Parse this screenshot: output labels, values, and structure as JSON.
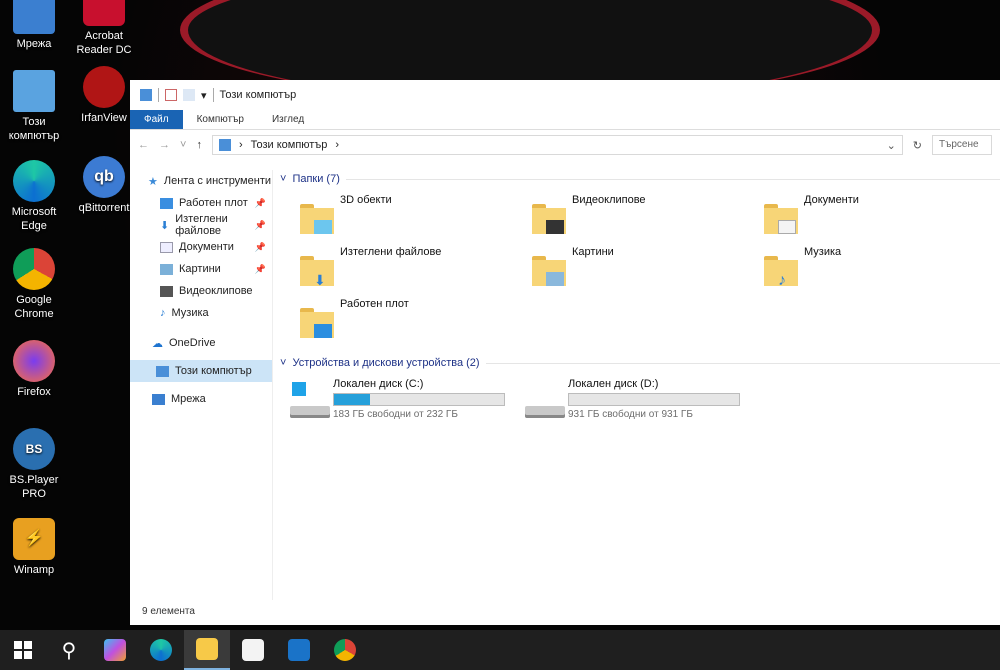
{
  "desktop": {
    "icons_left": [
      "Мрежа",
      "Този компютър",
      "Microsoft Edge",
      "Google Chrome",
      "Firefox",
      "BS.Player PRO",
      "Winamp"
    ],
    "icons_right": [
      "Acrobat Reader DC",
      "IrfanView",
      "qBittorrent"
    ]
  },
  "window": {
    "title": "Този компютър",
    "tabs": [
      "Файл",
      "Компютър",
      "Изглед"
    ],
    "address": "Този компютър",
    "search_placeholder": "Търсене",
    "nav": {
      "quick_access": "Лента с инструменти",
      "items": [
        "Работен плот",
        "Изтеглени файлове",
        "Документи",
        "Картини",
        "Видеоклипове",
        "Музика"
      ],
      "onedrive": "OneDrive",
      "this_pc": "Този компютър",
      "network": "Мрежа"
    },
    "folders_header": "Папки (7)",
    "folders": [
      "3D обекти",
      "Видеоклипове",
      "Документи",
      "Изтеглени файлове",
      "Картини",
      "Музика",
      "Работен плот"
    ],
    "drives_header": "Устройства и дискови устройства (2)",
    "drives": [
      {
        "name": "Локален диск (C:)",
        "free": "183 ГБ свободни от 232 ГБ",
        "used_fraction": 0.21
      },
      {
        "name": "Локален диск (D:)",
        "free": "931 ГБ свободни от 931 ГБ",
        "used_fraction": 0.0
      }
    ],
    "status": "9 елемента"
  },
  "taskbar": [
    "start",
    "search",
    "copilot",
    "edge",
    "file-explorer",
    "store",
    "outlook",
    "chrome"
  ]
}
